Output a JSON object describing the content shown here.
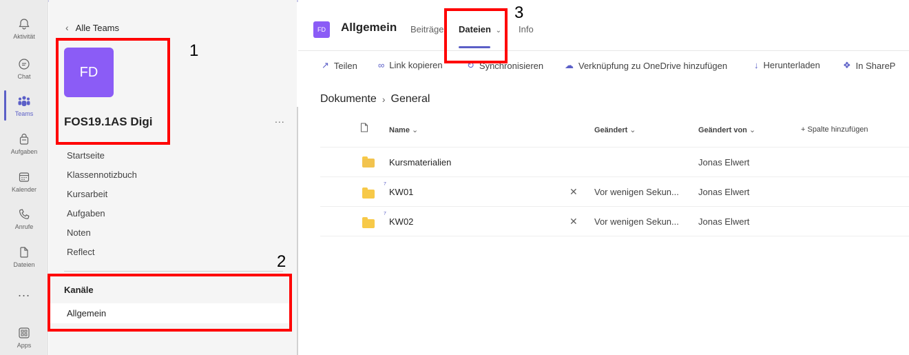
{
  "rail": {
    "items": [
      {
        "label": "Aktivität",
        "icon": "bell-icon"
      },
      {
        "label": "Chat",
        "icon": "chat-icon"
      },
      {
        "label": "Teams",
        "icon": "teams-icon",
        "active": true
      },
      {
        "label": "Aufgaben",
        "icon": "assignments-icon"
      },
      {
        "label": "Kalender",
        "icon": "calendar-icon"
      },
      {
        "label": "Anrufe",
        "icon": "phone-icon"
      },
      {
        "label": "Dateien",
        "icon": "file-icon"
      }
    ],
    "more": "...",
    "apps_label": "Apps"
  },
  "team": {
    "back_label": "Alle Teams",
    "avatar_initials": "FD",
    "name": "FOS19.1AS Digi",
    "more": "...",
    "nav": [
      "Startseite",
      "Klassennotizbuch",
      "Kursarbeit",
      "Aufgaben",
      "Noten",
      "Reflect"
    ],
    "channels_heading": "Kanäle",
    "channel": "Allgemein"
  },
  "channel_header": {
    "avatar_initials": "FD",
    "title": "Allgemein",
    "tabs": [
      "Beiträge",
      "Dateien",
      "Info"
    ],
    "active_tab": "Dateien"
  },
  "toolbar": {
    "share": "Teilen",
    "copy_link": "Link kopieren",
    "sync": "Synchronisieren",
    "onedrive": "Verknüpfung zu OneDrive hinzufügen",
    "download": "Herunterladen",
    "sharepoint": "In ShareP"
  },
  "breadcrumb": {
    "root": "Dokumente",
    "current": "General"
  },
  "table": {
    "headers": {
      "name": "Name",
      "modified": "Geändert",
      "modified_by": "Geändert von",
      "add_column": "+ Spalte hinzufügen"
    },
    "rows": [
      {
        "name": "Kursmaterialien",
        "modified": "",
        "modified_by": "Jonas Elwert"
      },
      {
        "name": "KW01",
        "modified": "Vor wenigen Sekun...",
        "modified_by": "Jonas Elwert"
      },
      {
        "name": "KW02",
        "modified": "Vor wenigen Sekun...",
        "modified_by": "Jonas Elwert"
      }
    ]
  },
  "annotations": [
    "1",
    "2",
    "3"
  ],
  "colors": {
    "accent": "#5b5fc7",
    "avatar": "#8b5cf6",
    "annotation": "#ff0000"
  }
}
